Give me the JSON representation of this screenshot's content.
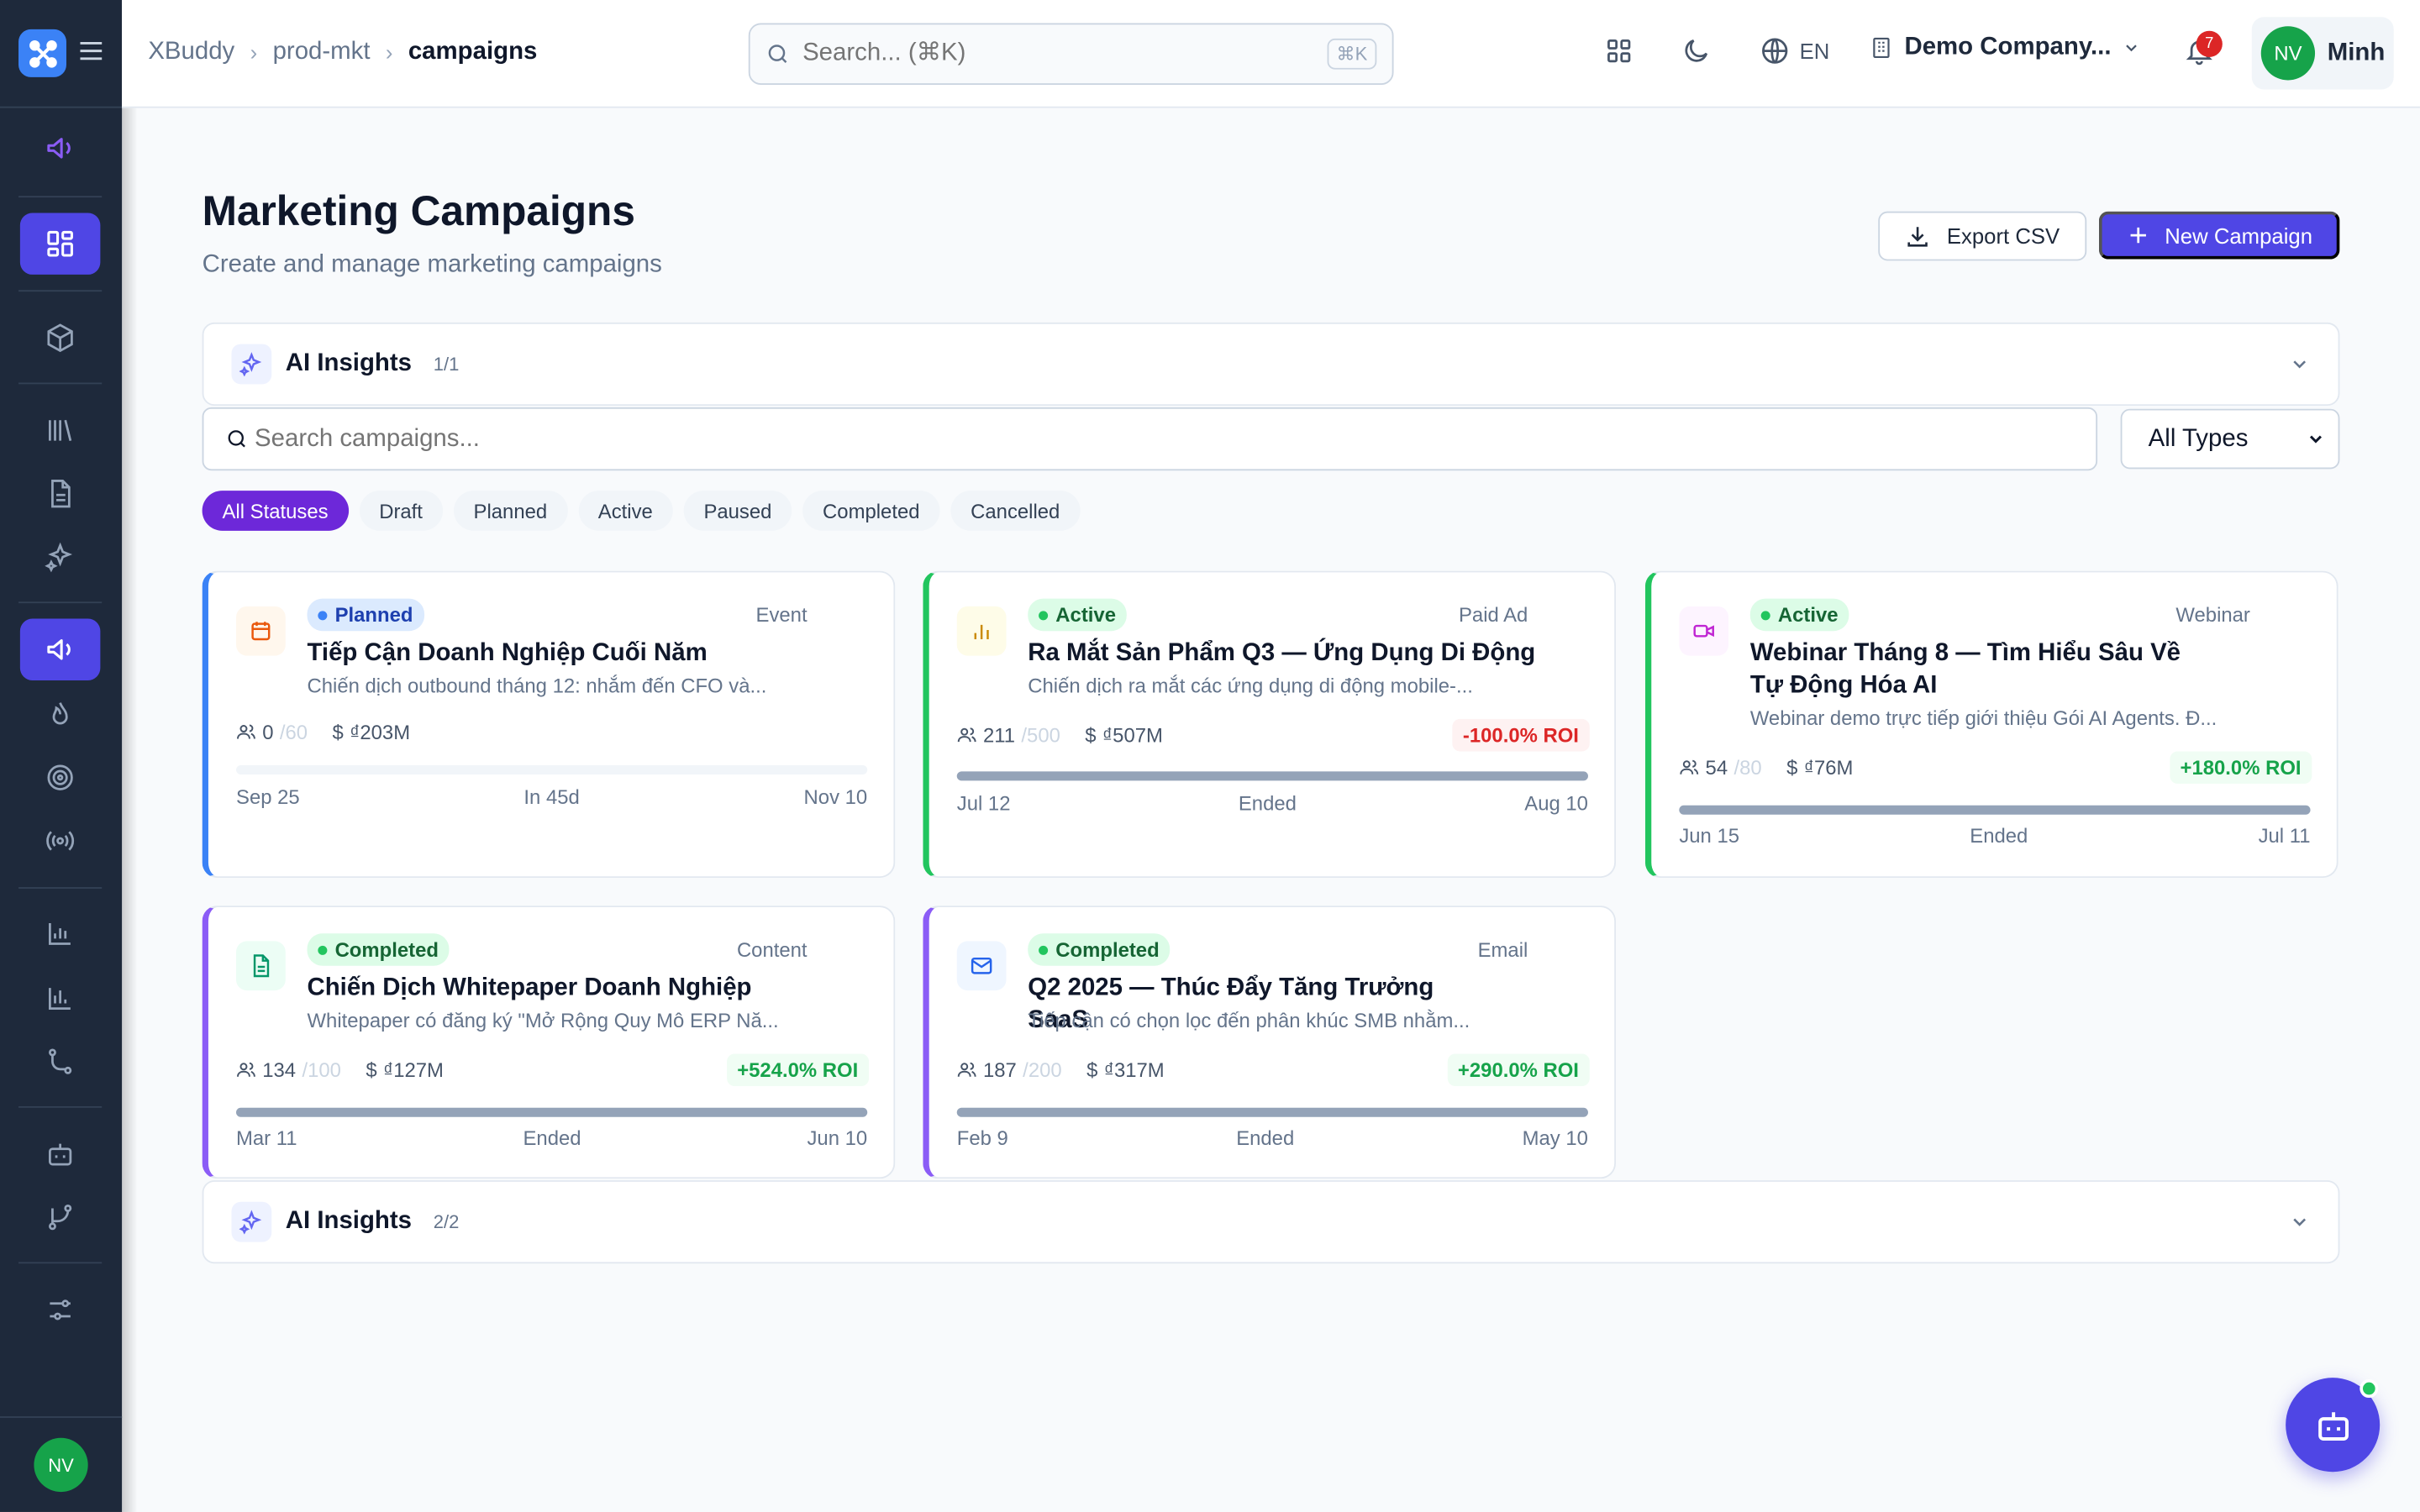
{
  "breadcrumb": [
    "XBuddy",
    "prod-mkt",
    "campaigns"
  ],
  "topbar": {
    "search_placeholder": "Search... (⌘K)",
    "shortcut": "⌘K",
    "language": "EN",
    "company": "Demo Company...",
    "notifications": "7",
    "user_initials": "NV",
    "user_name": "Minh"
  },
  "sidebar": {
    "avatar_initials": "NV"
  },
  "page": {
    "title": "Marketing Campaigns",
    "subtitle": "Create and manage marketing campaigns",
    "export_label": "Export CSV",
    "new_label": "New Campaign"
  },
  "insights_top": {
    "title": "AI Insights",
    "count": "1/1"
  },
  "insights_bottom": {
    "title": "AI Insights",
    "count": "2/2"
  },
  "filter": {
    "search_placeholder": "Search campaigns...",
    "type_selected": "All Types",
    "statuses": [
      "All Statuses",
      "Draft",
      "Planned",
      "Active",
      "Paused",
      "Completed",
      "Cancelled"
    ]
  },
  "cards": [
    {
      "status": "Planned",
      "type": "Event",
      "name": "Tiếp Cận Doanh Nghiệp Cuối Năm",
      "desc": "Chiến dịch outbound tháng 12: nhắm đến CFO và...",
      "leads": "0",
      "limit": "/60",
      "budget": "₫203M",
      "roi": "",
      "start": "Sep 25",
      "middle": "In 45d",
      "end": "Nov 10",
      "progress": 0
    },
    {
      "status": "Active",
      "type": "Paid Ad",
      "name": "Ra Mắt Sản Phẩm Q3 — Ứng Dụng Di Động",
      "desc": "Chiến dịch ra mắt các ứng dụng di động mobile-...",
      "leads": "211",
      "limit": "/500",
      "budget": "₫507M",
      "roi": "-100.0% ROI",
      "start": "Jul 12",
      "middle": "Ended",
      "end": "Aug 10",
      "progress": 100
    },
    {
      "status": "Active",
      "type": "Webinar",
      "name": "Webinar Tháng 8 — Tìm Hiểu Sâu Về Tự Động Hóa AI",
      "desc": "Webinar demo trực tiếp giới thiệu Gói AI Agents. Đ...",
      "leads": "54",
      "limit": "/80",
      "budget": "₫76M",
      "roi": "+180.0% ROI",
      "start": "Jun 15",
      "middle": "Ended",
      "end": "Jul 11",
      "progress": 100
    },
    {
      "status": "Completed",
      "type": "Content",
      "name": "Chiến Dịch Whitepaper Doanh Nghiệp",
      "desc": "Whitepaper có đăng ký \"Mở Rộng Quy Mô ERP Nă...",
      "leads": "134",
      "limit": "/100",
      "budget": "₫127M",
      "roi": "+524.0% ROI",
      "start": "Mar 11",
      "middle": "Ended",
      "end": "Jun 10",
      "progress": 100
    },
    {
      "status": "Completed",
      "type": "Email",
      "name": "Q2 2025 — Thúc Đẩy Tăng Trưởng SaaS",
      "desc": "Tiếp cận có chọn lọc đến phân khúc SMB nhằm...",
      "leads": "187",
      "limit": "/200",
      "budget": "₫317M",
      "roi": "+290.0% ROI",
      "start": "Feb 9",
      "middle": "Ended",
      "end": "May 10",
      "progress": 100
    }
  ],
  "colors": {
    "accent": "#4f46e5",
    "planned": "#3b82f6",
    "active": "#22c55e",
    "completed": "#8b5cf6"
  }
}
